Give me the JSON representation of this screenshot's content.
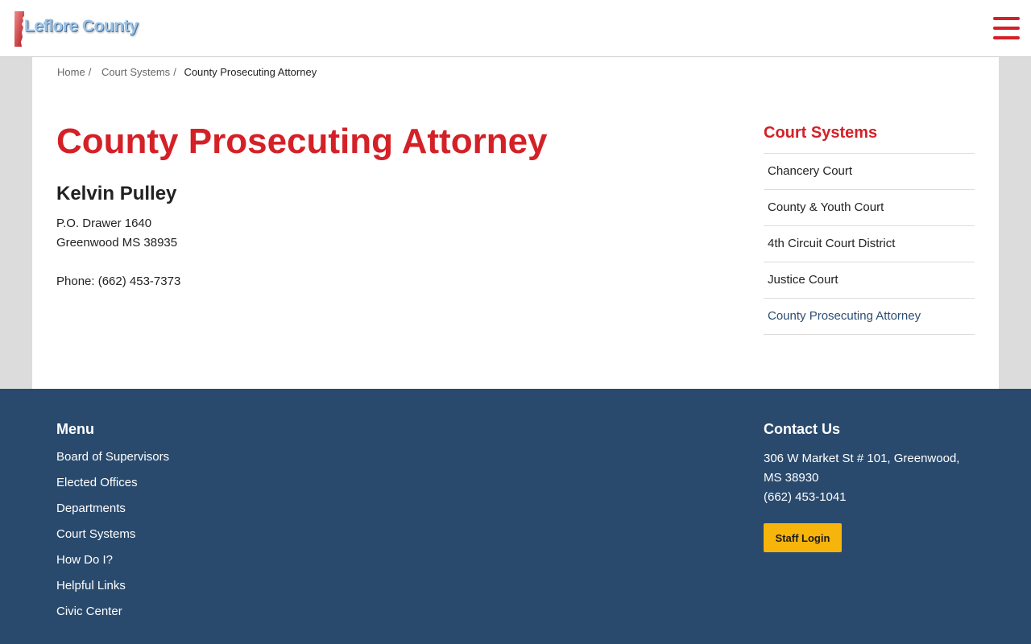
{
  "header": {
    "logo_text": "Leflore County",
    "menu_icon": "hamburger-menu-icon",
    "accent": "#d42027"
  },
  "breadcrumb": {
    "home": "Home",
    "sep": "/",
    "court_systems": "Court Systems",
    "current": "County Prosecuting Attorney"
  },
  "main": {
    "title": "County Prosecuting Attorney",
    "name": "Kelvin Pulley",
    "address_line1": "P.O. Drawer 1640",
    "address_line2": "Greenwood MS 38935",
    "phone": "Phone: (662) 453-7373"
  },
  "sidebar": {
    "title": "Court Systems",
    "items": [
      {
        "label": "Chancery Court"
      },
      {
        "label": "County & Youth Court"
      },
      {
        "label": "4th Circuit Court District"
      },
      {
        "label": "Justice Court"
      },
      {
        "label": "County Prosecuting Attorney"
      }
    ]
  },
  "footer": {
    "menu_title": "Menu",
    "menu_items": [
      {
        "label": "Board of Supervisors"
      },
      {
        "label": "Elected Offices"
      },
      {
        "label": "Departments"
      },
      {
        "label": "Court Systems"
      },
      {
        "label": "How Do I?"
      },
      {
        "label": "Helpful Links"
      },
      {
        "label": "Civic Center"
      }
    ],
    "contact_title": "Contact Us",
    "address_line1": "306 W Market St # 101, Greenwood,",
    "address_line2": "MS 38930",
    "phone": "(662) 453-1041",
    "staff_login": "Staff Login",
    "bg_color": "#294a6d",
    "button_color": "#f7b50c"
  }
}
